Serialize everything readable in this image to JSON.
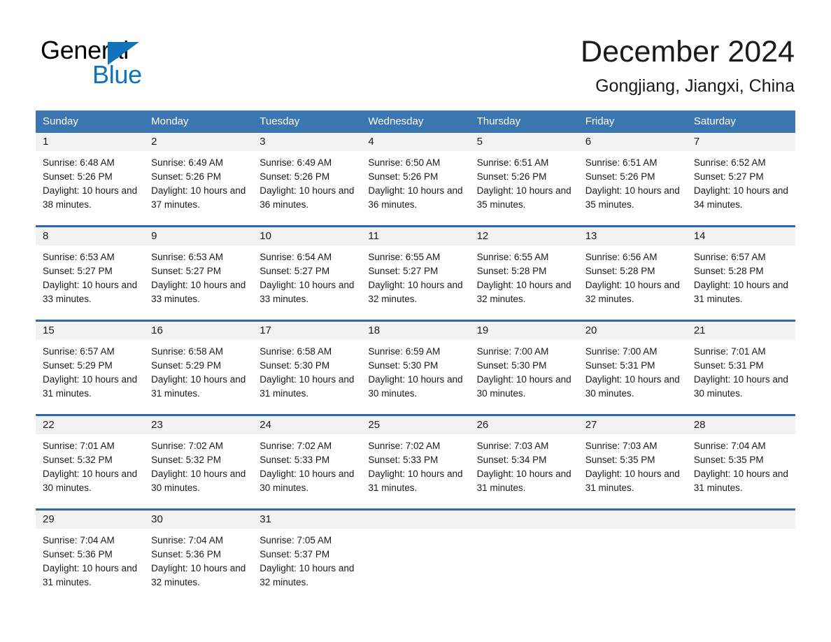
{
  "brand": {
    "name_part1": "General",
    "name_part2": "Blue",
    "accent_color": "#1072ba",
    "triangle_icon": "triangle-icon"
  },
  "header": {
    "month_title": "December 2024",
    "location": "Gongjiang, Jiangxi, China"
  },
  "calendar": {
    "header_color": "#3b76b0",
    "separator_color": "#2f6aa8",
    "day_band_color": "#f2f2f2",
    "weekdays": [
      "Sunday",
      "Monday",
      "Tuesday",
      "Wednesday",
      "Thursday",
      "Friday",
      "Saturday"
    ],
    "weeks": [
      [
        {
          "day": "1",
          "sunrise": "Sunrise: 6:48 AM",
          "sunset": "Sunset: 5:26 PM",
          "daylight": "Daylight: 10 hours and 38 minutes."
        },
        {
          "day": "2",
          "sunrise": "Sunrise: 6:49 AM",
          "sunset": "Sunset: 5:26 PM",
          "daylight": "Daylight: 10 hours and 37 minutes."
        },
        {
          "day": "3",
          "sunrise": "Sunrise: 6:49 AM",
          "sunset": "Sunset: 5:26 PM",
          "daylight": "Daylight: 10 hours and 36 minutes."
        },
        {
          "day": "4",
          "sunrise": "Sunrise: 6:50 AM",
          "sunset": "Sunset: 5:26 PM",
          "daylight": "Daylight: 10 hours and 36 minutes."
        },
        {
          "day": "5",
          "sunrise": "Sunrise: 6:51 AM",
          "sunset": "Sunset: 5:26 PM",
          "daylight": "Daylight: 10 hours and 35 minutes."
        },
        {
          "day": "6",
          "sunrise": "Sunrise: 6:51 AM",
          "sunset": "Sunset: 5:26 PM",
          "daylight": "Daylight: 10 hours and 35 minutes."
        },
        {
          "day": "7",
          "sunrise": "Sunrise: 6:52 AM",
          "sunset": "Sunset: 5:27 PM",
          "daylight": "Daylight: 10 hours and 34 minutes."
        }
      ],
      [
        {
          "day": "8",
          "sunrise": "Sunrise: 6:53 AM",
          "sunset": "Sunset: 5:27 PM",
          "daylight": "Daylight: 10 hours and 33 minutes."
        },
        {
          "day": "9",
          "sunrise": "Sunrise: 6:53 AM",
          "sunset": "Sunset: 5:27 PM",
          "daylight": "Daylight: 10 hours and 33 minutes."
        },
        {
          "day": "10",
          "sunrise": "Sunrise: 6:54 AM",
          "sunset": "Sunset: 5:27 PM",
          "daylight": "Daylight: 10 hours and 33 minutes."
        },
        {
          "day": "11",
          "sunrise": "Sunrise: 6:55 AM",
          "sunset": "Sunset: 5:27 PM",
          "daylight": "Daylight: 10 hours and 32 minutes."
        },
        {
          "day": "12",
          "sunrise": "Sunrise: 6:55 AM",
          "sunset": "Sunset: 5:28 PM",
          "daylight": "Daylight: 10 hours and 32 minutes."
        },
        {
          "day": "13",
          "sunrise": "Sunrise: 6:56 AM",
          "sunset": "Sunset: 5:28 PM",
          "daylight": "Daylight: 10 hours and 32 minutes."
        },
        {
          "day": "14",
          "sunrise": "Sunrise: 6:57 AM",
          "sunset": "Sunset: 5:28 PM",
          "daylight": "Daylight: 10 hours and 31 minutes."
        }
      ],
      [
        {
          "day": "15",
          "sunrise": "Sunrise: 6:57 AM",
          "sunset": "Sunset: 5:29 PM",
          "daylight": "Daylight: 10 hours and 31 minutes."
        },
        {
          "day": "16",
          "sunrise": "Sunrise: 6:58 AM",
          "sunset": "Sunset: 5:29 PM",
          "daylight": "Daylight: 10 hours and 31 minutes."
        },
        {
          "day": "17",
          "sunrise": "Sunrise: 6:58 AM",
          "sunset": "Sunset: 5:30 PM",
          "daylight": "Daylight: 10 hours and 31 minutes."
        },
        {
          "day": "18",
          "sunrise": "Sunrise: 6:59 AM",
          "sunset": "Sunset: 5:30 PM",
          "daylight": "Daylight: 10 hours and 30 minutes."
        },
        {
          "day": "19",
          "sunrise": "Sunrise: 7:00 AM",
          "sunset": "Sunset: 5:30 PM",
          "daylight": "Daylight: 10 hours and 30 minutes."
        },
        {
          "day": "20",
          "sunrise": "Sunrise: 7:00 AM",
          "sunset": "Sunset: 5:31 PM",
          "daylight": "Daylight: 10 hours and 30 minutes."
        },
        {
          "day": "21",
          "sunrise": "Sunrise: 7:01 AM",
          "sunset": "Sunset: 5:31 PM",
          "daylight": "Daylight: 10 hours and 30 minutes."
        }
      ],
      [
        {
          "day": "22",
          "sunrise": "Sunrise: 7:01 AM",
          "sunset": "Sunset: 5:32 PM",
          "daylight": "Daylight: 10 hours and 30 minutes."
        },
        {
          "day": "23",
          "sunrise": "Sunrise: 7:02 AM",
          "sunset": "Sunset: 5:32 PM",
          "daylight": "Daylight: 10 hours and 30 minutes."
        },
        {
          "day": "24",
          "sunrise": "Sunrise: 7:02 AM",
          "sunset": "Sunset: 5:33 PM",
          "daylight": "Daylight: 10 hours and 30 minutes."
        },
        {
          "day": "25",
          "sunrise": "Sunrise: 7:02 AM",
          "sunset": "Sunset: 5:33 PM",
          "daylight": "Daylight: 10 hours and 31 minutes."
        },
        {
          "day": "26",
          "sunrise": "Sunrise: 7:03 AM",
          "sunset": "Sunset: 5:34 PM",
          "daylight": "Daylight: 10 hours and 31 minutes."
        },
        {
          "day": "27",
          "sunrise": "Sunrise: 7:03 AM",
          "sunset": "Sunset: 5:35 PM",
          "daylight": "Daylight: 10 hours and 31 minutes."
        },
        {
          "day": "28",
          "sunrise": "Sunrise: 7:04 AM",
          "sunset": "Sunset: 5:35 PM",
          "daylight": "Daylight: 10 hours and 31 minutes."
        }
      ],
      [
        {
          "day": "29",
          "sunrise": "Sunrise: 7:04 AM",
          "sunset": "Sunset: 5:36 PM",
          "daylight": "Daylight: 10 hours and 31 minutes."
        },
        {
          "day": "30",
          "sunrise": "Sunrise: 7:04 AM",
          "sunset": "Sunset: 5:36 PM",
          "daylight": "Daylight: 10 hours and 32 minutes."
        },
        {
          "day": "31",
          "sunrise": "Sunrise: 7:05 AM",
          "sunset": "Sunset: 5:37 PM",
          "daylight": "Daylight: 10 hours and 32 minutes."
        },
        {
          "day": "",
          "sunrise": "",
          "sunset": "",
          "daylight": ""
        },
        {
          "day": "",
          "sunrise": "",
          "sunset": "",
          "daylight": ""
        },
        {
          "day": "",
          "sunrise": "",
          "sunset": "",
          "daylight": ""
        },
        {
          "day": "",
          "sunrise": "",
          "sunset": "",
          "daylight": ""
        }
      ]
    ]
  }
}
